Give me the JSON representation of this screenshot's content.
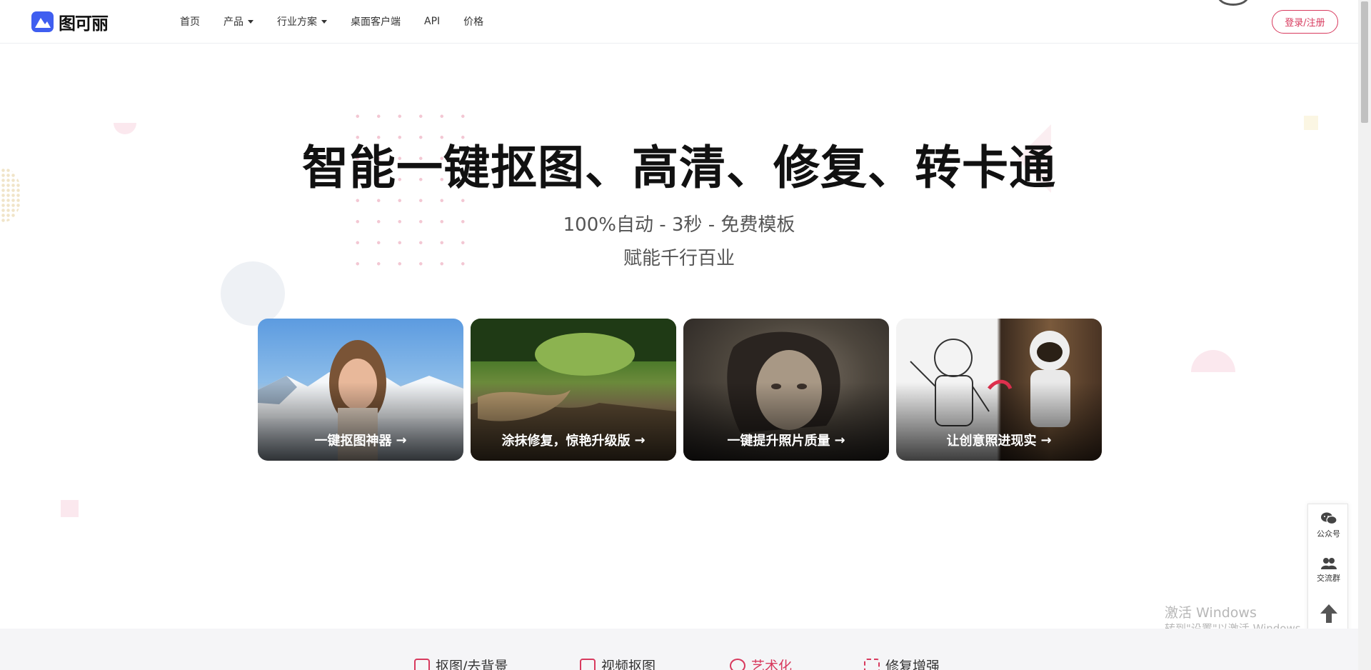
{
  "header": {
    "logo_text": "图可丽",
    "nav": [
      "首页",
      "产品",
      "行业方案",
      "桌面客户端",
      "API",
      "价格"
    ],
    "login_label": "登录/注册"
  },
  "hero": {
    "title": "智能一键抠图、高清、修复、转卡通",
    "subtitle_line1": "100%自动 - 3秒 - 免费模板",
    "subtitle_line2": "赋能千行百业"
  },
  "cards": [
    {
      "label": "一键抠图神器"
    },
    {
      "label": "涂抹修复，惊艳升级版"
    },
    {
      "label": "一键提升照片质量"
    },
    {
      "label": "让创意照进现实"
    }
  ],
  "side_bar": {
    "wechat_label": "公众号",
    "group_label": "交流群"
  },
  "watermark": {
    "line1": "激活 Windows",
    "line2": "转到\"设置\"以激活 Windows。"
  },
  "tabs": [
    {
      "label": "抠图/去背景",
      "active": false
    },
    {
      "label": "视频抠图",
      "active": false
    },
    {
      "label": "艺术化",
      "active": true
    },
    {
      "label": "修复增强",
      "active": false
    }
  ],
  "colors": {
    "accent": "#d83a5e",
    "logo_blue": "#3f5ef0"
  }
}
